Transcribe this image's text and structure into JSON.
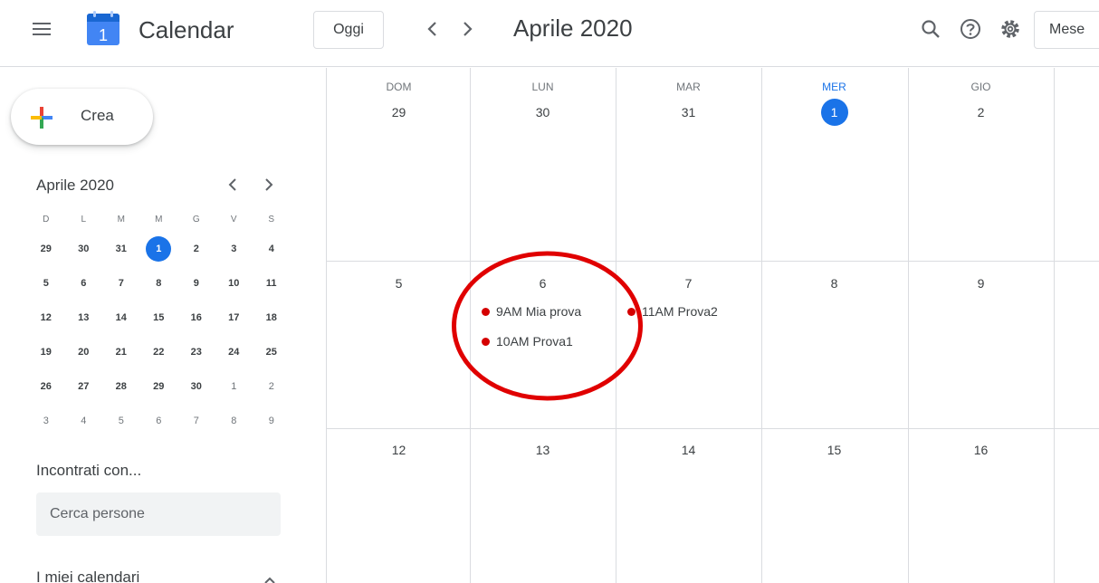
{
  "header": {
    "app_title": "Calendar",
    "logo_number": "1",
    "today_label": "Oggi",
    "date_title": "Aprile 2020",
    "view_label": "Mese"
  },
  "sidebar": {
    "create_label": "Crea",
    "mini_title": "Aprile 2020",
    "mini_dow": [
      "D",
      "L",
      "M",
      "M",
      "G",
      "V",
      "S"
    ],
    "mini_weeks": [
      [
        "29",
        "30",
        "31",
        "1",
        "2",
        "3",
        "4"
      ],
      [
        "5",
        "6",
        "7",
        "8",
        "9",
        "10",
        "11"
      ],
      [
        "12",
        "13",
        "14",
        "15",
        "16",
        "17",
        "18"
      ],
      [
        "19",
        "20",
        "21",
        "22",
        "23",
        "24",
        "25"
      ],
      [
        "26",
        "27",
        "28",
        "29",
        "30",
        "1",
        "2"
      ],
      [
        "3",
        "4",
        "5",
        "6",
        "7",
        "8",
        "9"
      ]
    ],
    "people_title": "Incontrati con...",
    "people_placeholder": "Cerca persone",
    "mycal_title": "I miei calendari"
  },
  "grid": {
    "columns": [
      {
        "dow": "DOM",
        "date": "29"
      },
      {
        "dow": "LUN",
        "date": "30"
      },
      {
        "dow": "MAR",
        "date": "31"
      },
      {
        "dow": "MER",
        "date": "1"
      },
      {
        "dow": "GIO",
        "date": "2"
      }
    ],
    "week2": [
      "5",
      "6",
      "7",
      "8",
      "9"
    ],
    "week3": [
      "12",
      "13",
      "14",
      "15",
      "16"
    ],
    "events": [
      {
        "time": "9AM",
        "title": "Mia prova"
      },
      {
        "time": "10AM",
        "title": "Prova1"
      },
      {
        "time": "11AM",
        "title": "Prova2"
      }
    ]
  },
  "colors": {
    "accent": "#1a73e8",
    "event_dot": "#d50000",
    "annotation": "#e00000"
  },
  "icons": [
    "menu-icon",
    "calendar-logo-icon",
    "chevron-left-icon",
    "chevron-right-icon",
    "search-icon",
    "help-icon",
    "settings-icon",
    "plus-icon"
  ]
}
